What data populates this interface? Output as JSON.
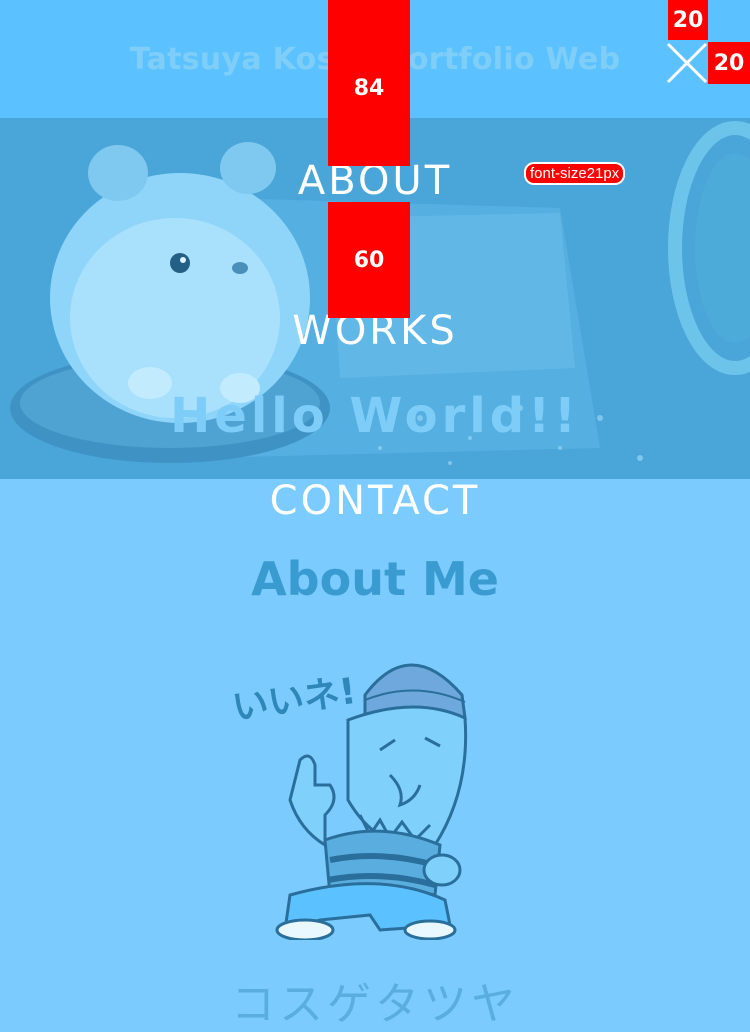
{
  "header": {
    "site_title": "Tatsuya Koske Portfolio Web"
  },
  "hero": {
    "heading": "Hello World!!"
  },
  "menu": {
    "items": [
      {
        "label": "ABOUT"
      },
      {
        "label": "WORKS"
      },
      {
        "label": "CONTACT"
      }
    ],
    "close_icon": "close-icon"
  },
  "annotations": {
    "spacing_top": "84",
    "spacing_between": "60",
    "icon_size_h": "20",
    "icon_size_w": "20",
    "font_size_note": "font-size21px"
  },
  "about": {
    "section_title": "About Me",
    "illustration_text": "いいネ!",
    "name": "コスゲタツヤ"
  },
  "colors": {
    "header_bg": "#5cc2ff",
    "page_bg": "#7bcbff",
    "hero_overlay": "#52aee2",
    "annotation": "#ff0000"
  }
}
